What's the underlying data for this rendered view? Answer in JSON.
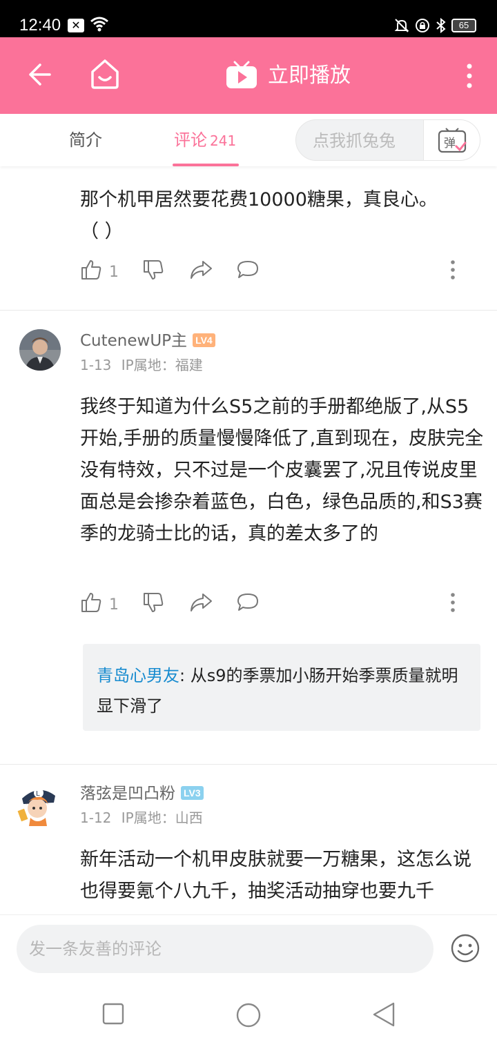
{
  "status_bar": {
    "time": "12:40",
    "x_badge": "✕",
    "battery": "65"
  },
  "app_bar": {
    "title": "立即播放"
  },
  "tabs": {
    "intro": "简介",
    "comments": "评论",
    "comment_count": "241",
    "danmaku_placeholder": "点我抓兔兔"
  },
  "comments": [
    {
      "text_line1": "那个机甲居然要花费10000糖果，真良心。",
      "text_line2": "（    ）",
      "likes": "1"
    },
    {
      "username": "CutenewUP主",
      "level": "LV4",
      "date": "1-13",
      "ip": "IP属地：福建",
      "text": "我终于知道为什么S5之前的手册都绝版了,从S5开始,手册的质量慢慢降低了,直到现在，皮肤完全没有特效，只不过是一个皮囊罢了,况且传说皮里面总是会掺杂着蓝色，白色，绿色品质的,和S3赛季的龙骑士比的话，真的差太多了的",
      "likes": "1",
      "reply": {
        "user": "青岛心男友",
        "text": ": 从s9的季票加小肠开始季票质量就明显下滑了"
      }
    },
    {
      "username": "落弦是凹凸粉",
      "level": "LV3",
      "date": "1-12",
      "ip": "IP属地：山西",
      "text": "新年活动一个机甲皮肤就要一万糖果，这怎么说也得要氪个八九千，抽奖活动抽穿也要九千"
    }
  ],
  "input_bar": {
    "placeholder": "发一条友善的评论"
  },
  "colors": {
    "brand_pink": "#fb7299",
    "reply_blue": "#178bcf",
    "lv4": "#ffb27a",
    "lv3": "#8bd1ef"
  }
}
